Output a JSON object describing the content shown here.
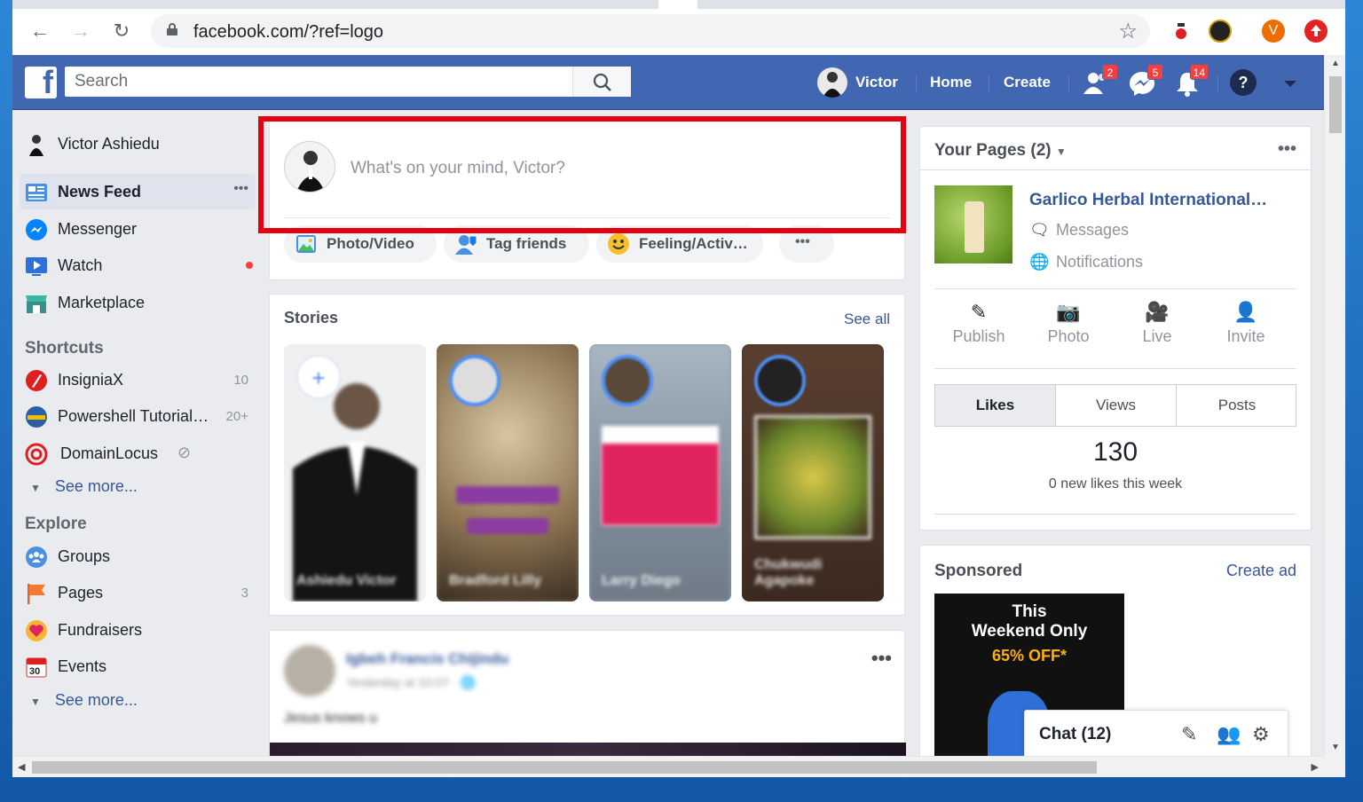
{
  "browser": {
    "url": "facebook.com/?ref=logo",
    "profile_initial": "V"
  },
  "fb": {
    "logo_letter": "f",
    "search_placeholder": "Search",
    "user_name": "Victor",
    "home_label": "Home",
    "create_label": "Create",
    "friend_requests_count": "2",
    "messages_count": "5",
    "notifications_count": "14",
    "help_label": "?"
  },
  "leftnav": {
    "profile_name": "Victor Ashiedu",
    "items": [
      {
        "label": "News Feed",
        "icon": "news-feed-icon"
      },
      {
        "label": "Messenger",
        "icon": "messenger-icon"
      },
      {
        "label": "Watch",
        "icon": "watch-icon"
      },
      {
        "label": "Marketplace",
        "icon": "marketplace-icon"
      }
    ],
    "more_dots": "•••",
    "shortcuts_heading": "Shortcuts",
    "shortcuts": [
      {
        "label": "InsigniaX",
        "count": "10"
      },
      {
        "label": "Powershell Tutorial…",
        "count": "20+"
      },
      {
        "label": "DomainLocus",
        "count": ""
      }
    ],
    "see_more_1": "See more...",
    "explore_heading": "Explore",
    "explore": [
      {
        "label": "Groups",
        "count": ""
      },
      {
        "label": "Pages",
        "count": "3"
      },
      {
        "label": "Fundraisers",
        "count": ""
      },
      {
        "label": "Events",
        "count": ""
      }
    ],
    "events_day": "30",
    "see_more_2": "See more..."
  },
  "composer": {
    "prompt": "What's on your mind, Victor?",
    "actions": [
      {
        "label": "Photo/Video"
      },
      {
        "label": "Tag friends"
      },
      {
        "label": "Feeling/Activ…"
      }
    ],
    "more": "•••"
  },
  "stories": {
    "title": "Stories",
    "see_all": "See all",
    "names": [
      "Ashiedu Victor",
      "Bradford Lilly",
      "Larry Diego",
      "Chukwudi Agapoke"
    ]
  },
  "post": {
    "author": "Igbeh Francis Chijindu",
    "meta": "Yesterday at 10:07 · 🌐",
    "text": "Jesus knows u",
    "more": "•••"
  },
  "your_pages": {
    "title": "Your Pages (2)",
    "more": "•••",
    "page_name": "Garlico Herbal International…",
    "messages_label": "Messages",
    "notifications_label": "Notifications",
    "actions": [
      {
        "label": "Publish"
      },
      {
        "label": "Photo"
      },
      {
        "label": "Live"
      },
      {
        "label": "Invite"
      }
    ],
    "tabs": [
      {
        "label": "Likes"
      },
      {
        "label": "Views"
      },
      {
        "label": "Posts"
      }
    ],
    "likes_count": "130",
    "likes_sub": "0 new likes this week"
  },
  "sponsored": {
    "title": "Sponsored",
    "create_ad": "Create ad",
    "ad_line1": "This",
    "ad_line2": "Weekend Only",
    "ad_line3": "65% OFF*"
  },
  "chat": {
    "label": "Chat (12)"
  },
  "colors": {
    "fb_blue": "#4267b2",
    "link_blue": "#365899",
    "highlight_red": "#e3000f",
    "badge_red": "#fa3e3e"
  }
}
